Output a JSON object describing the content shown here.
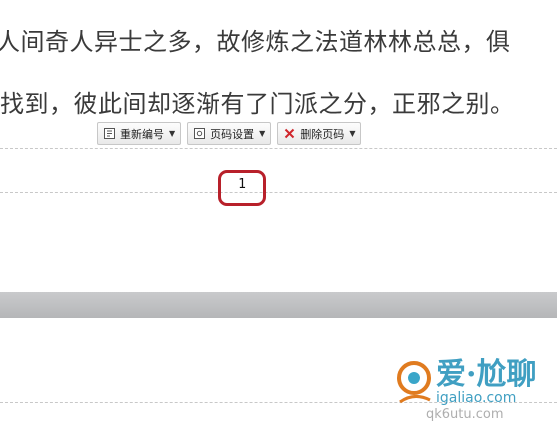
{
  "document": {
    "line1": "人间奇人异士之多，故修炼之法道林林总总，俱",
    "line2": "找到，彼此间却逐渐有了门派之分，正邪之别。"
  },
  "toolbar": {
    "renumber_label": "重新编号",
    "settings_label": "页码设置",
    "delete_label": "删除页码"
  },
  "page_number": "1",
  "colors": {
    "highlight_border": "#b8202a",
    "page_gap": "#bfc0c2"
  },
  "watermark": {
    "logo_text": "爱·尬聊",
    "url": "igaliao.com",
    "alt_url": "qk6utu.com"
  }
}
